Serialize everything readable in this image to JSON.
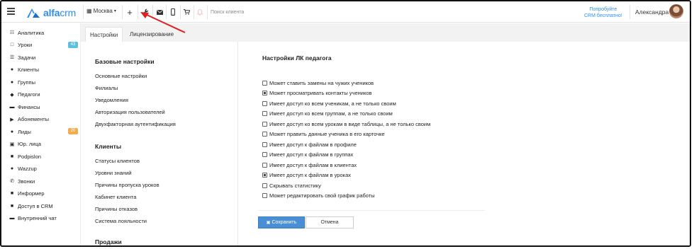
{
  "header": {
    "branch": "Москва",
    "search_placeholder": "Поиск клиента",
    "trial_line1": "Попробуйте",
    "trial_line2": "CRM бесплатно!",
    "user_name": "Александра",
    "logo_brand": "alfa",
    "logo_suffix": "crm"
  },
  "sidebar": {
    "items": [
      {
        "label": "Аналитика",
        "icon": "bar-chart-icon"
      },
      {
        "label": "Уроки",
        "icon": "calendar-icon",
        "badge": "43",
        "badge_color": "#5bc0de"
      },
      {
        "label": "Задачи",
        "icon": "tasks-icon"
      },
      {
        "label": "Клиенты",
        "icon": "user-icon"
      },
      {
        "label": "Группы",
        "icon": "users-icon"
      },
      {
        "label": "Педагоги",
        "icon": "graduation-cap-icon"
      },
      {
        "label": "Финансы",
        "icon": "money-icon"
      },
      {
        "label": "Абонементы",
        "icon": "tag-icon"
      },
      {
        "label": "Лиды",
        "icon": "user-plus-icon",
        "badge": "20",
        "badge_color": "#f0ad4e"
      },
      {
        "label": "Юр. лица",
        "icon": "briefcase-icon"
      },
      {
        "label": "Podpislon",
        "icon": "podpislon-icon"
      },
      {
        "label": "Wazzup",
        "icon": "whatsapp-icon"
      },
      {
        "label": "Звонки",
        "icon": "phone-icon"
      },
      {
        "label": "Информер",
        "icon": "informer-icon"
      },
      {
        "label": "Доступ в CRM",
        "icon": "lock-icon"
      },
      {
        "label": "Внутренний чат",
        "icon": "chat-icon"
      }
    ]
  },
  "tabs": [
    {
      "label": "Настройки",
      "active": true
    },
    {
      "label": "Лицензирование",
      "active": false
    }
  ],
  "left_sections": [
    {
      "title": "Базовые настройки",
      "links": [
        "Основные настройки",
        "Филиалы",
        "Уведомления",
        "Авторизация пользователей",
        "Двухфакторная аутентификация"
      ]
    },
    {
      "title": "Клиенты",
      "links": [
        "Статусы клиентов",
        "Уровни знаний",
        "Причины пропуска уроков",
        "Кабинет клиента",
        "Причины отказов",
        "Система лояльности"
      ]
    },
    {
      "title": "Продажи",
      "links": []
    }
  ],
  "settings": {
    "title": "Настройки ЛК педагога",
    "options": [
      {
        "label": "Может ставить замены на чужих учеников",
        "checked": false
      },
      {
        "label": "Может просматривать контакты учеников",
        "checked": true
      },
      {
        "label": "Имеет доступ ко всем ученикам, а не только своим",
        "checked": false
      },
      {
        "label": "Имеет доступ ко всем группам, а не только своим",
        "checked": false
      },
      {
        "label": "Имеет доступ ко всем урокам в виде таблицы, а не только своим",
        "checked": false
      },
      {
        "label": "Может править данные ученика в его карточке",
        "checked": false
      },
      {
        "label": "Имеет доступ к файлам в профиле",
        "checked": false
      },
      {
        "label": "Имеет доступ к файлам в группах",
        "checked": false
      },
      {
        "label": "Имеет доступ к файлам в клиентах",
        "checked": false
      },
      {
        "label": "Имеет доступ к файлам в уроках",
        "checked": true
      },
      {
        "label": "Скрывать статистику",
        "checked": false
      },
      {
        "label": "Может редактировать свой график работы",
        "checked": false
      }
    ],
    "save_label": "Сохранить",
    "cancel_label": "Отмена"
  },
  "colors": {
    "accent": "#2d8ee8",
    "save_button": "#4a8fd4",
    "annotation_arrow": "#e02020"
  }
}
